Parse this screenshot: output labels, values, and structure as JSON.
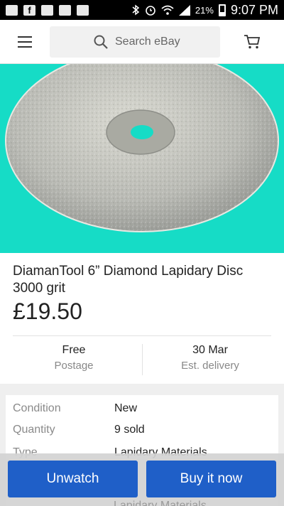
{
  "status_bar": {
    "battery": "21%",
    "time": "9:07 PM"
  },
  "header": {
    "search_placeholder": "Search eBay"
  },
  "product": {
    "title": "DiamanTool 6” Diamond Lapidary Disc 3000 grit",
    "price": "£19.50"
  },
  "shipping": {
    "postage": {
      "value": "Free",
      "label": "Postage"
    },
    "delivery": {
      "value": "30 Mar",
      "label": "Est. delivery"
    }
  },
  "details": [
    {
      "label": "Condition",
      "value": "New"
    },
    {
      "label": "Quantity",
      "value": "9 sold"
    },
    {
      "label": "Type",
      "value": "Lapidary Materials"
    }
  ],
  "obscured_text": "Lapidary Materials",
  "actions": {
    "unwatch": "Unwatch",
    "buy_now": "Buy it now"
  },
  "colors": {
    "accent": "#1f5fc8",
    "hero_bg": "#16dcc6"
  },
  "icons": [
    "notification-icon",
    "facebook-icon",
    "mail-icon",
    "gmail-icon",
    "inbox-icon",
    "bluetooth-icon",
    "alarm-icon",
    "wifi-icon",
    "signal-icon",
    "battery-icon",
    "menu-icon",
    "search-icon",
    "cart-icon"
  ]
}
